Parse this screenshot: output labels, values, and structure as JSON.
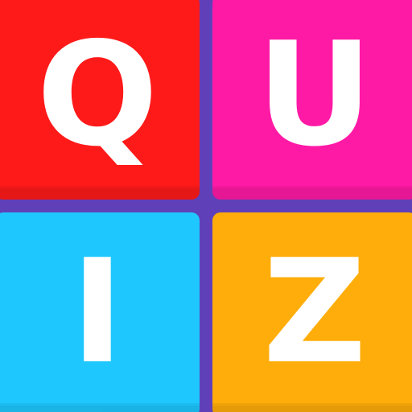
{
  "tiles": [
    {
      "letter": "Q",
      "color": "#ff1a1a",
      "shade": "#e01010"
    },
    {
      "letter": "U",
      "color": "#ff1aa6",
      "shade": "#e0108f"
    },
    {
      "letter": "I",
      "color": "#1ec8ff",
      "shade": "#14b0e6"
    },
    {
      "letter": "Z",
      "color": "#ffad0a",
      "shade": "#f09a00"
    }
  ],
  "colors": {
    "background": "#6040b8"
  }
}
